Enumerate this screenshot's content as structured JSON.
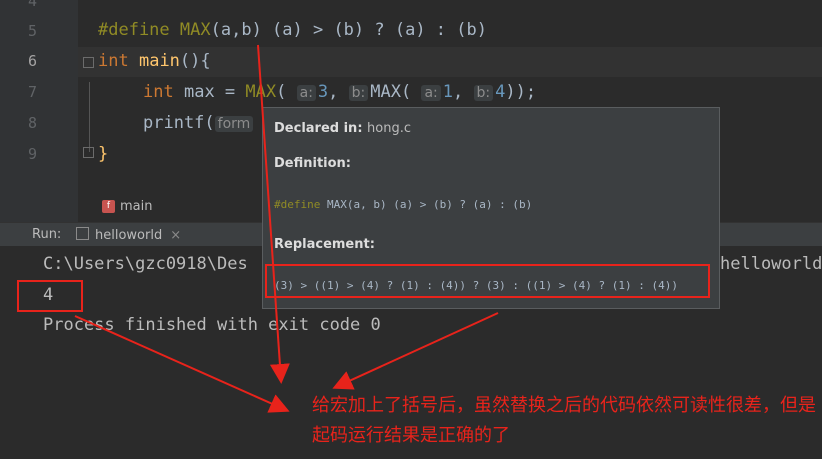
{
  "editor": {
    "line_numbers": [
      "4",
      "5",
      "6",
      "7",
      "8",
      "9"
    ],
    "line5": {
      "directive": "#define",
      "macro": "MAX",
      "rest": "(a,b) (a) > (b) ? (a) : (b)"
    },
    "line6": {
      "kw": "int",
      "fn": "main",
      "rest": "(){"
    },
    "line7": {
      "kw": "int",
      "var": "max = ",
      "macro": "MAX",
      "p1": "(",
      "hint_a": "a:",
      "n3": "3",
      "comma": ",",
      "hint_b": "b:",
      "inner": "MAX(",
      "hint_a2": "a:",
      "n1": "1",
      "comma2": ",",
      "hint_b2": "b:",
      "n4": "4",
      "tail": "));"
    },
    "line8": {
      "call": "printf(",
      "hint": "form"
    },
    "line9": {
      "brace": "}"
    },
    "breadcrumb": {
      "icon": "f",
      "label": "main"
    }
  },
  "run": {
    "label": "Run:",
    "tab": "helloworld"
  },
  "console": {
    "path": "C:\\Users\\gzc0918\\Des",
    "path_tail": "helloworld",
    "result": "4",
    "exit": "Process finished with exit code 0"
  },
  "tooltip": {
    "declared_label": "Declared in:",
    "declared_file": "hong.c",
    "definition_label": "Definition:",
    "definition_code": "#define MAX(a, b) (a) > (b) ? (a) : (b)",
    "replacement_label": "Replacement:",
    "replacement_code": "(3) > ((1) > (4) ? (1) : (4)) ? (3) : ((1) > (4) ? (1) : (4))"
  },
  "annotation": {
    "text": "给宏加上了括号后，虽然替换之后的代码依然可读性很差，但是起码运行结果是正确的了",
    "color": "#e8231b"
  }
}
